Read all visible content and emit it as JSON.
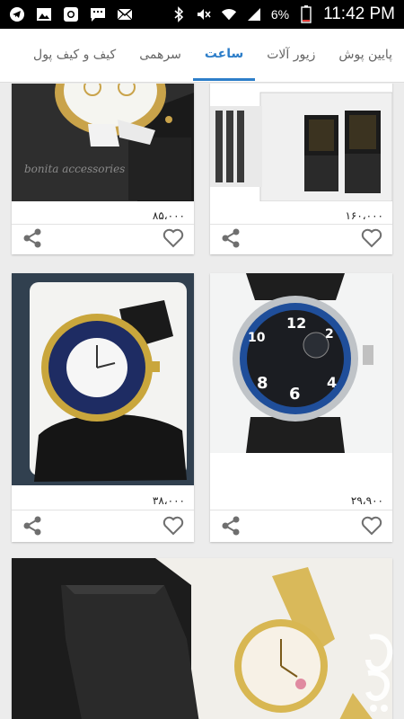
{
  "statusbar": {
    "battery_percent": "6%",
    "time": "11:42 PM",
    "left_icons": [
      "telegram-icon",
      "gallery-icon",
      "instagram-icon",
      "message-icon",
      "mail-icon"
    ],
    "right_icons": [
      "bluetooth-icon",
      "mute-icon",
      "wifi-icon",
      "signal-icon",
      "battery-icon"
    ]
  },
  "tabs": [
    {
      "label": "پایین پوش",
      "active": false
    },
    {
      "label": "زیور آلات",
      "active": false
    },
    {
      "label": "ساعت",
      "active": true
    },
    {
      "label": "سرهمی",
      "active": false
    },
    {
      "label": "کیف و کیف پول",
      "active": false
    }
  ],
  "colors": {
    "accent": "#2d7ec9",
    "background": "#ececec",
    "icon_gray": "#6f6f6f"
  },
  "products": [
    {
      "price": "۸۵،۰۰۰",
      "image": "white-gold-watch-photo",
      "watermark_text": "bonita accessories"
    },
    {
      "price": "۱۶۰،۰۰۰",
      "image": "black-pair-watches-photo"
    },
    {
      "price": "۳۸،۰۰۰",
      "image": "blue-dial-gold-watch-photo"
    },
    {
      "price": "۲۹،۹۰۰",
      "image": "black-chronograph-watch-photo",
      "dial_numbers": [
        "12",
        "2",
        "4",
        "6",
        "8",
        "10"
      ]
    },
    {
      "image": "gold-bracelet-watch-photo"
    }
  ],
  "store_watermark": "bazaar-logo-icon"
}
